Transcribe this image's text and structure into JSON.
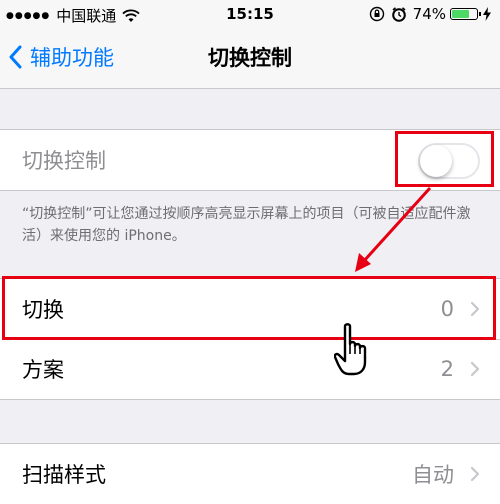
{
  "status_bar": {
    "carrier": "中国联通",
    "time": "15:15",
    "battery": "74%",
    "battery_level": 0.74
  },
  "nav": {
    "back_label": "辅助功能",
    "title": "切换控制"
  },
  "toggle_row": {
    "label": "切换控制",
    "enabled": false
  },
  "description": "“切换控制”可让您通过按顺序高亮显示屏幕上的项目（可被自适应配件激活）来使用您的 iPhone。",
  "rows": [
    {
      "label": "切换",
      "value": "0"
    },
    {
      "label": "方案",
      "value": "2"
    }
  ],
  "scan_row": {
    "label": "扫描样式",
    "value": "自动"
  },
  "colors": {
    "accent": "#007aff",
    "annotation": "#e60012",
    "battery": "#4cd964"
  }
}
